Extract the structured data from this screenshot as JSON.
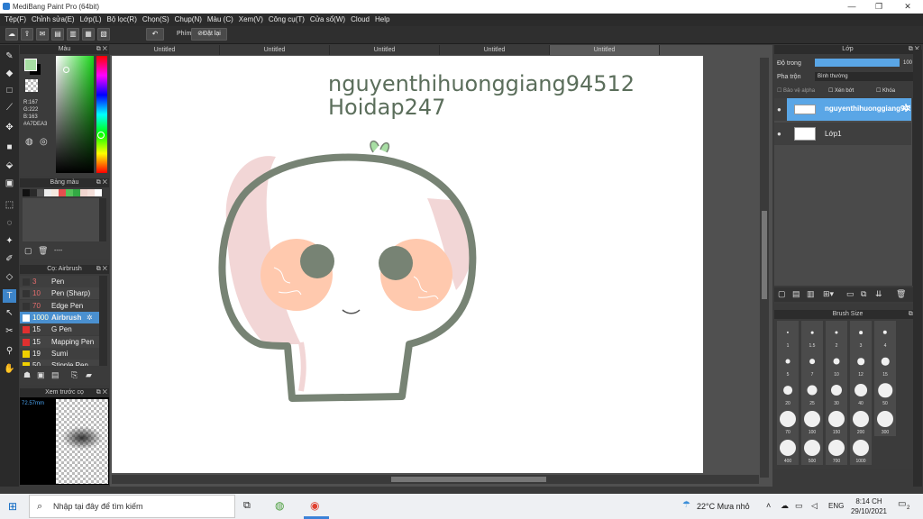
{
  "titlebar": {
    "title": "MediBang Paint Pro (64bit)",
    "minimize": "—",
    "maximize": "❐",
    "close": "✕"
  },
  "menu": [
    "Tệp(F)",
    "Chỉnh sửa(E)",
    "Lớp(L)",
    "Bộ lọc(R)",
    "Chọn(S)",
    "Chụp(N)",
    "Màu (C)",
    "Xem(V)",
    "Công cụ(T)",
    "Cửa sổ(W)",
    "Cloud",
    "Help"
  ],
  "toolbar": {
    "shortcut_label": "Phím",
    "reset_label": "Đặt lại"
  },
  "color_panel": {
    "title": "Màu",
    "r": "R:167",
    "g": "G:222",
    "b": "B:163",
    "hex": "#A7DEA3",
    "current_color": "#a7dea3"
  },
  "palette_panel": {
    "title": "Bảng màu",
    "swatches": [
      "#111111",
      "#2a2a2a",
      "#555555",
      "#eeeeee",
      "#f5e9df",
      "#e44f4f",
      "#55c45a",
      "#33aa44",
      "#f2d6d0",
      "#f5e0da",
      "#ffffff"
    ],
    "footer": "----"
  },
  "brush_panel": {
    "title": "Cọ: Airbrush",
    "brushes": [
      {
        "size": "3",
        "name": "Pen",
        "color": "#333333"
      },
      {
        "size": "10",
        "name": "Pen (Sharp)",
        "color": "#333333"
      },
      {
        "size": "70",
        "name": "Edge Pen",
        "color": "#333333"
      },
      {
        "size": "1000",
        "name": "Airbrush",
        "color": "#ffffff"
      },
      {
        "size": "15",
        "name": "G Pen",
        "color": "#e03030"
      },
      {
        "size": "15",
        "name": "Mapping Pen",
        "color": "#e03030"
      },
      {
        "size": "19",
        "name": "Sumi",
        "color": "#f0d000"
      },
      {
        "size": "50",
        "name": "Stipple Pen",
        "color": "#f0d000"
      }
    ]
  },
  "preview_panel": {
    "title": "Xem trước cọ",
    "size": "72.57mm"
  },
  "document_tabs": [
    "Untitled",
    "Untitled",
    "Untitled",
    "Untitled",
    "Untitled"
  ],
  "canvas": {
    "watermark_line1": "nguyenthihuonggiang94512",
    "watermark_line2": "Hoidap247"
  },
  "layer_panel": {
    "title": "Lớp",
    "opacity_label": "Độ trong",
    "opacity_value": "100 %",
    "opacity_fraction": 1.0,
    "blend_label": "Pha trộn",
    "blend_value": "Bình thường",
    "protect_alpha": "Bảo vệ alpha",
    "clipping": "Xén bớt",
    "lock": "Khóa",
    "layers": [
      {
        "name": "nguyenthihuonggiang94512",
        "selected": true
      },
      {
        "name": "Lớp1",
        "selected": false
      }
    ]
  },
  "brush_size_panel": {
    "title": "Brush Size",
    "sizes": [
      "1",
      "1.5",
      "2",
      "3",
      "4",
      "5",
      "7",
      "10",
      "12",
      "15",
      "20",
      "25",
      "30",
      "40",
      "50",
      "70",
      "100",
      "150",
      "200",
      "300",
      "400",
      "500",
      "700",
      "1000"
    ]
  },
  "taskbar": {
    "search_placeholder": "Nhập tại đây để tìm kiếm",
    "weather": "22°C  Mưa nhỏ",
    "lang": "ENG",
    "time": "8:14 CH",
    "date": "29/10/2021",
    "notifications": "2"
  }
}
